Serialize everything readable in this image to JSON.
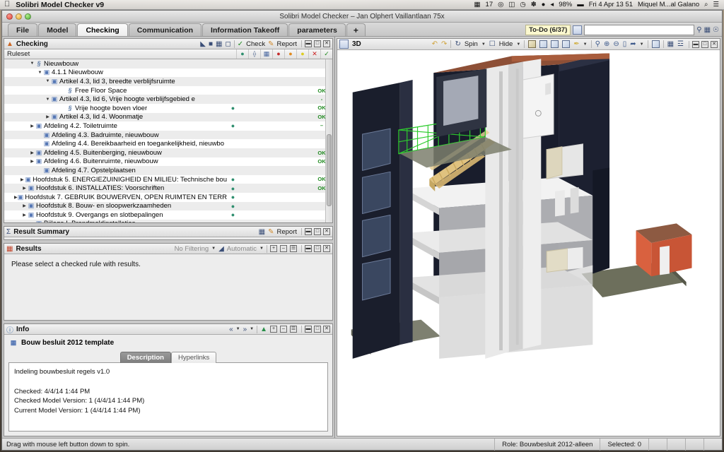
{
  "menubar": {
    "apple": "",
    "app_name": "Solibri Model Checker v9",
    "right_items": [
      {
        "name": "activity-indicator",
        "text": "17"
      },
      {
        "name": "dropbox-icon",
        "text": "◍"
      },
      {
        "name": "battery-warning-icon",
        "text": "◫"
      },
      {
        "name": "clock-history-icon",
        "text": "◷"
      },
      {
        "name": "bluetooth-icon",
        "text": "✻"
      },
      {
        "name": "wifi-icon",
        "text": "✧"
      },
      {
        "name": "volume-icon",
        "text": "◄"
      },
      {
        "name": "battery-percent",
        "text": "98%"
      },
      {
        "name": "battery-icon",
        "text": "▭"
      },
      {
        "name": "date-time",
        "text": "Fri 4 Apr  13 51"
      },
      {
        "name": "user-name",
        "text": "Miquel M...al Galano"
      },
      {
        "name": "spotlight-icon",
        "text": "⌕"
      },
      {
        "name": "notification-center-icon",
        "text": "☰"
      }
    ]
  },
  "window": {
    "title": "Solibri Model Checker – Jan Olphert Vaillantlaan 75x"
  },
  "tabs": [
    {
      "label": "File",
      "active": false
    },
    {
      "label": "Model",
      "active": false
    },
    {
      "label": "Checking",
      "active": true
    },
    {
      "label": "Communication",
      "active": false
    },
    {
      "label": "Information Takeoff",
      "active": false
    },
    {
      "label": "parameters",
      "active": false
    },
    {
      "label": "+",
      "active": false,
      "plus": true
    }
  ],
  "todo": {
    "badge": "To-Do (6/37)",
    "search_value": "",
    "search_placeholder": "",
    "icons": [
      "binoculars-icon",
      "save-icon",
      "help-icon"
    ]
  },
  "checking_panel": {
    "title": "Checking",
    "tools": [
      "open-icon",
      "stop-icon",
      "save-icon",
      "folder-icon"
    ],
    "check_label": "Check",
    "report_label": "Report",
    "window_buttons": [
      "minimize",
      "maximize",
      "close"
    ]
  },
  "tree": {
    "header_label": "Ruleset",
    "header_columns": [
      "globe-icon",
      "wrench-icon",
      "table-icon",
      "critical-icon",
      "moderate-icon",
      "low-icon",
      "rejected-icon",
      "accepted-icon"
    ],
    "rows": [
      {
        "indent": 3,
        "arrow": "down",
        "icon": "section",
        "label": "Nieuwbouw",
        "globe": "",
        "status": ""
      },
      {
        "indent": 4,
        "arrow": "down",
        "icon": "doc",
        "label": "4.1.1 Nieuwbouw",
        "globe": "",
        "status": ""
      },
      {
        "indent": 5,
        "arrow": "down",
        "icon": "doc",
        "label": "Artikel 4.3, lid 3, breedte verblijfsruimte",
        "globe": "",
        "status": ""
      },
      {
        "indent": 7,
        "arrow": "none",
        "icon": "section",
        "label": "Free Floor Space",
        "globe": "",
        "status": "OK"
      },
      {
        "indent": 5,
        "arrow": "down",
        "icon": "doc",
        "label": "Artikel 4.3, lid 6, Vrije hoogte verblijfsgebied e",
        "globe": "",
        "status": "-"
      },
      {
        "indent": 7,
        "arrow": "none",
        "icon": "section",
        "label": "Vrije hoogte boven vloer",
        "globe": "globe",
        "status": "OK"
      },
      {
        "indent": 5,
        "arrow": "right",
        "icon": "doc",
        "label": "Artikel 4.3, lid 4. Woonmatje",
        "globe": "",
        "status": "OK"
      },
      {
        "indent": 3,
        "arrow": "right",
        "icon": "doc",
        "label": "Afdeling 4.2. Toiletruimte",
        "globe": "globe",
        "status": "–"
      },
      {
        "indent": 4,
        "arrow": "none",
        "icon": "doc",
        "label": "Afdeling 4.3. Badruimte, nieuwbouw",
        "globe": "",
        "status": ""
      },
      {
        "indent": 4,
        "arrow": "none",
        "icon": "doc",
        "label": "Afdeling 4.4. Bereikbaarheid en toegankelijkheid, nieuwbo",
        "globe": "",
        "status": ""
      },
      {
        "indent": 3,
        "arrow": "right",
        "icon": "doc",
        "label": "Afdeling 4.5. Buitenberging, nieuwbouw",
        "globe": "",
        "status": "OK"
      },
      {
        "indent": 3,
        "arrow": "right",
        "icon": "doc",
        "label": "Afdeling 4.6. Buitenruimte, nieuwbouw",
        "globe": "",
        "status": "OK"
      },
      {
        "indent": 4,
        "arrow": "none",
        "icon": "doc",
        "label": "Afdeling 4.7. Opstelplaatsen",
        "globe": "",
        "status": ""
      },
      {
        "indent": 2,
        "arrow": "right",
        "icon": "doc",
        "label": "Hoofdstuk 5. ENERGIEZUINIGHEID EN MILIEU: Technische bou",
        "globe": "globe",
        "status": "OK"
      },
      {
        "indent": 2,
        "arrow": "right",
        "icon": "doc",
        "label": "Hoofdstuk 6. INSTALLATIES: Voorschriften",
        "globe": "globe",
        "status": "OK"
      },
      {
        "indent": 2,
        "arrow": "right",
        "icon": "doc",
        "label": "Hoofdstuk 7. GEBRUIK BOUWERVEN, OPEN RUIMTEN EN TERR",
        "globe": "globe",
        "status": ""
      },
      {
        "indent": 2,
        "arrow": "right",
        "icon": "doc",
        "label": "Hoofdstuk 8. Bouw- en sloopwerkzaamheden",
        "globe": "globe",
        "status": ""
      },
      {
        "indent": 2,
        "arrow": "right",
        "icon": "doc",
        "label": "Hoofdstuk 9. Overgangs en slotbepalingen",
        "globe": "globe",
        "status": ""
      },
      {
        "indent": 3,
        "arrow": "none",
        "icon": "doc",
        "label": "Bijlage I. Brandmeldinstallaties",
        "globe": "globe",
        "status": ""
      }
    ]
  },
  "result_summary": {
    "title": "Result Summary",
    "report_label": "Report",
    "icons": [
      "chart-icon",
      "report-icon"
    ]
  },
  "results": {
    "title": "Results",
    "filter_label": "No Filtering",
    "grouping_label": "Automatic",
    "zoom_icons": [
      "expand-icon",
      "collapse-icon",
      "fit-icon"
    ],
    "message": "Please select a checked rule with results."
  },
  "info": {
    "title": "Info",
    "nav_icons": [
      "back-icon",
      "back-menu-icon",
      "forward-icon",
      "forward-menu-icon",
      "home-icon"
    ],
    "item_label": "Bouw besluit 2012 template",
    "subtabs": [
      {
        "label": "Description",
        "active": true
      },
      {
        "label": "Hyperlinks",
        "active": false
      }
    ],
    "description": "Indeling bouwbesluit regels v1.0\n\nChecked: 4/4/14 1:44 PM\nChecked Model Version: 1 (4/4/14 1:44 PM)\nCurrent Model Version: 1 (4/4/14 1:44 PM)"
  },
  "view3d": {
    "title": "3D",
    "spin_label": "Spin",
    "hide_label": "Hide",
    "icons": [
      "undo-icon",
      "redo-icon",
      "spin-icon",
      "hide-icon",
      "shaded-cube-icon",
      "wireframe-cube-icon",
      "hidden-line-cube-icon",
      "transparent-cube-icon",
      "paint-icon",
      "zoom-selected-icon",
      "zoom-in-icon",
      "zoom-out-icon",
      "zoom-area-icon",
      "measure-icon",
      "clip-icon",
      "section-icon",
      "layers-icon"
    ],
    "window_buttons": [
      "minimize",
      "maximize",
      "close"
    ]
  },
  "statusbar": {
    "hint": "Drag with mouse left button down to spin.",
    "role": "Role: Bouwbesluit 2012-alleen",
    "selected": "Selected: 0"
  },
  "colors": {
    "accent_blue": "#3f5b8c",
    "ok_green": "#1f8a1f",
    "todo_yellow": "#fbf8cf",
    "model_dark": "#1c2030",
    "model_orange": "#d9613f",
    "model_ground": "#6d6f5c",
    "model_stairs": "#e3c88a",
    "model_rail_green": "#2ecc2e"
  }
}
